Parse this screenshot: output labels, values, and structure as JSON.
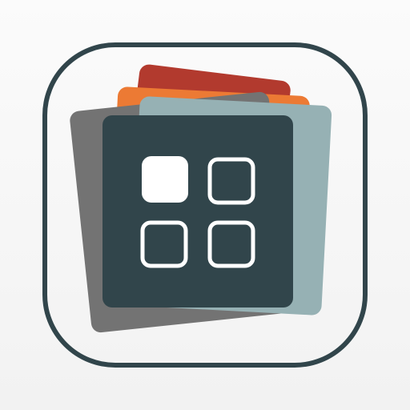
{
  "icon": {
    "name": "app-switcher-icon",
    "colors": {
      "background": "#f6f6f6",
      "frame_stroke": "#31454b",
      "front_card": "#31454b",
      "card_red": "#b23a2e",
      "card_orange": "#ec7a34",
      "card_light_teal": "#96b1b4",
      "card_gray": "#737373",
      "tile_fill": "#ffffff",
      "tile_stroke": "#ffffff"
    },
    "tiles": [
      {
        "name": "tile-top-left",
        "filled": true
      },
      {
        "name": "tile-top-right",
        "filled": false
      },
      {
        "name": "tile-bottom-left",
        "filled": false
      },
      {
        "name": "tile-bottom-right",
        "filled": false
      }
    ]
  }
}
